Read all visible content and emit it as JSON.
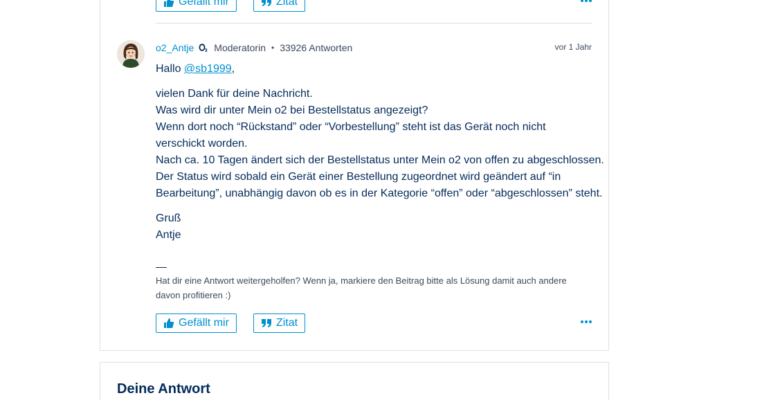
{
  "prev_post": {
    "like_label": "Gefällt mir",
    "quote_label": "Zitat"
  },
  "post": {
    "author": "o2_Antje",
    "role": "Moderatorin",
    "separator": "•",
    "answers": "33926 Antworten",
    "time": "vor 1 Jahr",
    "greeting_prefix": "Hallo ",
    "mention": "@sb1999",
    "greeting_suffix": ",",
    "lines": [
      "vielen Dank für deine Nachricht.",
      "Was wird dir unter Mein o2 bei Bestellstatus angezeigt?",
      "Wenn dort noch “Rückstand” oder “Vorbestellung” steht ist das Gerät noch nicht",
      "verschickt worden.",
      "Nach ca. 10 Tagen ändert sich der Bestellstatus unter Mein o2 von offen zu abgeschlossen.",
      "Der Status wird sobald ein Gerät einer Bestellung zugeordnet wird geändert auf “in",
      "Bearbeitung”, unabhängig davon ob es in der Kategorie “offen” oder “abgeschlossen” steht."
    ],
    "closing": [
      "Gruß",
      "Antje"
    ],
    "signature": "Hat dir eine Antwort weitergeholfen? Wenn ja, markiere den Beitrag bitte als Lösung damit auch andere davon profitieren :)",
    "like_label": "Gefällt mir",
    "quote_label": "Zitat"
  },
  "reply": {
    "title": "Deine Antwort"
  },
  "colors": {
    "accent": "#0090d0",
    "text": "#032b5a",
    "border": "#dcdfe3"
  }
}
